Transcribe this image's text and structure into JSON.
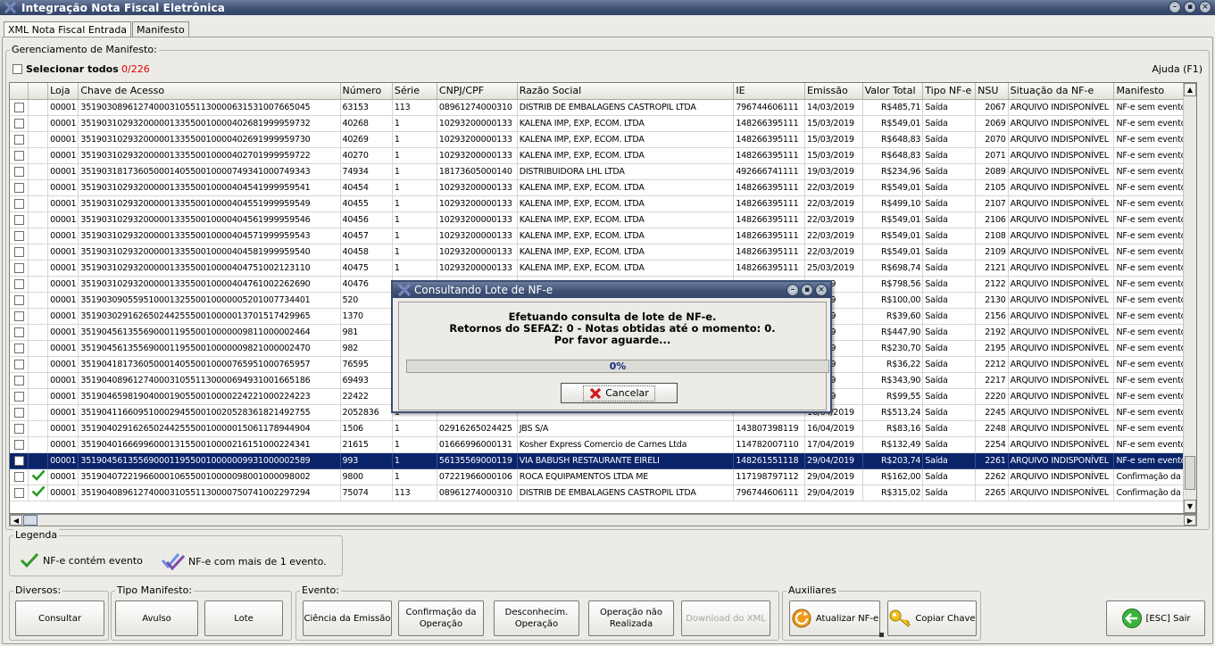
{
  "window": {
    "title": "Integração Nota Fiscal Eletrônica"
  },
  "tabs": [
    {
      "label": "XML Nota Fiscal Entrada"
    },
    {
      "label": "Manifesto"
    }
  ],
  "manager": {
    "legend": "Gerenciamento de Manifesto:",
    "select_all": "Selecionar todos",
    "count": "0/226",
    "help": "Ajuda (F1)"
  },
  "grid": {
    "columns": [
      "",
      "",
      "Loja",
      "Chave de Acesso",
      "Número",
      "Série",
      "CNPJ/CPF",
      "Razão Social",
      "IE",
      "Emissão",
      "Valor Total",
      "Tipo NF-e",
      "NSU",
      "Situação da NF-e",
      "Manifesto"
    ],
    "rows": [
      {
        "loja": "00001",
        "chave": "35190308961274000310551130000631531007665045",
        "numero": "63153",
        "serie": "113",
        "cnpj": "08961274000310",
        "razao": "DISTRIB DE EMBALAGENS CASTROPIL LTDA",
        "ie": "796744606111",
        "emissao": "14/03/2019",
        "valor": "R$485,71",
        "tipo": "Saída",
        "nsu": "2067",
        "situacao": "ARQUIVO INDISPONÍVEL",
        "manifesto": "NF-e sem evento",
        "evento": false,
        "selected": false
      },
      {
        "loja": "00001",
        "chave": "35190310293200000133550010000402681999959732",
        "numero": "40268",
        "serie": "1",
        "cnpj": "10293200000133",
        "razao": "KALENA IMP, EXP, ECOM. LTDA",
        "ie": "148266395111",
        "emissao": "15/03/2019",
        "valor": "R$549,01",
        "tipo": "Saída",
        "nsu": "2069",
        "situacao": "ARQUIVO INDISPONÍVEL",
        "manifesto": "NF-e sem evento",
        "evento": false,
        "selected": false
      },
      {
        "loja": "00001",
        "chave": "35190310293200000133550010000402691999959730",
        "numero": "40269",
        "serie": "1",
        "cnpj": "10293200000133",
        "razao": "KALENA IMP, EXP, ECOM. LTDA",
        "ie": "148266395111",
        "emissao": "15/03/2019",
        "valor": "R$648,83",
        "tipo": "Saída",
        "nsu": "2070",
        "situacao": "ARQUIVO INDISPONÍVEL",
        "manifesto": "NF-e sem evento",
        "evento": false,
        "selected": false
      },
      {
        "loja": "00001",
        "chave": "35190310293200000133550010000402701999959722",
        "numero": "40270",
        "serie": "1",
        "cnpj": "10293200000133",
        "razao": "KALENA IMP, EXP, ECOM. LTDA",
        "ie": "148266395111",
        "emissao": "15/03/2019",
        "valor": "R$648,83",
        "tipo": "Saída",
        "nsu": "2071",
        "situacao": "ARQUIVO INDISPONÍVEL",
        "manifesto": "NF-e sem evento",
        "evento": false,
        "selected": false
      },
      {
        "loja": "00001",
        "chave": "35190318173605000140550010000749341000749343",
        "numero": "74934",
        "serie": "1",
        "cnpj": "18173605000140",
        "razao": "DISTRIBUIDORA LHL LTDA",
        "ie": "492666741111",
        "emissao": "19/03/2019",
        "valor": "R$234,96",
        "tipo": "Saída",
        "nsu": "2089",
        "situacao": "ARQUIVO INDISPONÍVEL",
        "manifesto": "NF-e sem evento",
        "evento": false,
        "selected": false
      },
      {
        "loja": "00001",
        "chave": "35190310293200000133550010000404541999959541",
        "numero": "40454",
        "serie": "1",
        "cnpj": "10293200000133",
        "razao": "KALENA IMP, EXP, ECOM. LTDA",
        "ie": "148266395111",
        "emissao": "22/03/2019",
        "valor": "R$549,01",
        "tipo": "Saída",
        "nsu": "2105",
        "situacao": "ARQUIVO INDISPONÍVEL",
        "manifesto": "NF-e sem evento",
        "evento": false,
        "selected": false
      },
      {
        "loja": "00001",
        "chave": "35190310293200000133550010000404551999959549",
        "numero": "40455",
        "serie": "1",
        "cnpj": "10293200000133",
        "razao": "KALENA IMP, EXP, ECOM. LTDA",
        "ie": "148266395111",
        "emissao": "22/03/2019",
        "valor": "R$499,10",
        "tipo": "Saída",
        "nsu": "2107",
        "situacao": "ARQUIVO INDISPONÍVEL",
        "manifesto": "NF-e sem evento",
        "evento": false,
        "selected": false
      },
      {
        "loja": "00001",
        "chave": "35190310293200000133550010000404561999959546",
        "numero": "40456",
        "serie": "1",
        "cnpj": "10293200000133",
        "razao": "KALENA IMP, EXP, ECOM. LTDA",
        "ie": "148266395111",
        "emissao": "22/03/2019",
        "valor": "R$549,01",
        "tipo": "Saída",
        "nsu": "2106",
        "situacao": "ARQUIVO INDISPONÍVEL",
        "manifesto": "NF-e sem evento",
        "evento": false,
        "selected": false
      },
      {
        "loja": "00001",
        "chave": "35190310293200000133550010000404571999959543",
        "numero": "40457",
        "serie": "1",
        "cnpj": "10293200000133",
        "razao": "KALENA IMP, EXP, ECOM. LTDA",
        "ie": "148266395111",
        "emissao": "22/03/2019",
        "valor": "R$549,01",
        "tipo": "Saída",
        "nsu": "2108",
        "situacao": "ARQUIVO INDISPONÍVEL",
        "manifesto": "NF-e sem evento",
        "evento": false,
        "selected": false
      },
      {
        "loja": "00001",
        "chave": "35190310293200000133550010000404581999959540",
        "numero": "40458",
        "serie": "1",
        "cnpj": "10293200000133",
        "razao": "KALENA IMP, EXP, ECOM. LTDA",
        "ie": "148266395111",
        "emissao": "22/03/2019",
        "valor": "R$549,01",
        "tipo": "Saída",
        "nsu": "2109",
        "situacao": "ARQUIVO INDISPONÍVEL",
        "manifesto": "NF-e sem evento",
        "evento": false,
        "selected": false
      },
      {
        "loja": "00001",
        "chave": "35190310293200000133550010000404751002123110",
        "numero": "40475",
        "serie": "1",
        "cnpj": "10293200000133",
        "razao": "KALENA IMP, EXP, ECOM. LTDA",
        "ie": "148266395111",
        "emissao": "25/03/2019",
        "valor": "R$698,74",
        "tipo": "Saída",
        "nsu": "2121",
        "situacao": "ARQUIVO INDISPONÍVEL",
        "manifesto": "NF-e sem evento",
        "evento": false,
        "selected": false
      },
      {
        "loja": "00001",
        "chave": "35190310293200000133550010000404761002262690",
        "numero": "40476",
        "serie": "",
        "cnpj": "",
        "razao": "",
        "ie": "",
        "emissao": "3/2019",
        "valor": "R$798,56",
        "tipo": "Saída",
        "nsu": "2122",
        "situacao": "ARQUIVO INDISPONÍVEL",
        "manifesto": "NF-e sem evento",
        "evento": false,
        "selected": false
      },
      {
        "loja": "00001",
        "chave": "35190309055951000132550010000005201007734401",
        "numero": "520",
        "serie": "",
        "cnpj": "",
        "razao": "",
        "ie": "",
        "emissao": "3/2019",
        "valor": "R$100,00",
        "tipo": "Saída",
        "nsu": "2130",
        "situacao": "ARQUIVO INDISPONÍVEL",
        "manifesto": "NF-e sem evento",
        "evento": false,
        "selected": false
      },
      {
        "loja": "00001",
        "chave": "35190302916265024425550010000013701517429965",
        "numero": "1370",
        "serie": "",
        "cnpj": "",
        "razao": "",
        "ie": "",
        "emissao": "3/2019",
        "valor": "R$39,60",
        "tipo": "Saída",
        "nsu": "2156",
        "situacao": "ARQUIVO INDISPONÍVEL",
        "manifesto": "NF-e sem evento",
        "evento": false,
        "selected": false
      },
      {
        "loja": "00001",
        "chave": "35190456135569000119550010000009811000002464",
        "numero": "981",
        "serie": "",
        "cnpj": "",
        "razao": "",
        "ie": "",
        "emissao": "4/2019",
        "valor": "R$447,90",
        "tipo": "Saída",
        "nsu": "2192",
        "situacao": "ARQUIVO INDISPONÍVEL",
        "manifesto": "NF-e sem evento",
        "evento": false,
        "selected": false
      },
      {
        "loja": "00001",
        "chave": "35190456135569000119550010000009821000002470",
        "numero": "982",
        "serie": "",
        "cnpj": "",
        "razao": "",
        "ie": "",
        "emissao": "4/2019",
        "valor": "R$230,70",
        "tipo": "Saída",
        "nsu": "2195",
        "situacao": "ARQUIVO INDISPONÍVEL",
        "manifesto": "NF-e sem evento",
        "evento": false,
        "selected": false
      },
      {
        "loja": "00001",
        "chave": "35190418173605000140550010000765951000765957",
        "numero": "76595",
        "serie": "",
        "cnpj": "",
        "razao": "",
        "ie": "",
        "emissao": "4/2019",
        "valor": "R$36,22",
        "tipo": "Saída",
        "nsu": "2212",
        "situacao": "ARQUIVO INDISPONÍVEL",
        "manifesto": "NF-e sem evento",
        "evento": false,
        "selected": false
      },
      {
        "loja": "00001",
        "chave": "35190408961274000310551130000694931001665186",
        "numero": "69493",
        "serie": "",
        "cnpj": "",
        "razao": "",
        "ie": "",
        "emissao": "4/2019",
        "valor": "R$343,90",
        "tipo": "Saída",
        "nsu": "2217",
        "situacao": "ARQUIVO INDISPONÍVEL",
        "manifesto": "NF-e sem evento",
        "evento": false,
        "selected": false
      },
      {
        "loja": "00001",
        "chave": "35190465981904000190550010000224221000224223",
        "numero": "22422",
        "serie": "",
        "cnpj": "",
        "razao": "",
        "ie": "",
        "emissao": "4/2019",
        "valor": "R$99,55",
        "tipo": "Saída",
        "nsu": "2220",
        "situacao": "ARQUIVO INDISPONÍVEL",
        "manifesto": "NF-e sem evento",
        "evento": false,
        "selected": false
      },
      {
        "loja": "00001",
        "chave": "35190411660951000294550010020528361821492755",
        "numero": "2052836",
        "serie": "1",
        "cnpj": "",
        "razao": "",
        "ie": "",
        "emissao": "16/04/2019",
        "valor": "R$513,24",
        "tipo": "Saída",
        "nsu": "2245",
        "situacao": "ARQUIVO INDISPONÍVEL",
        "manifesto": "NF-e sem evento",
        "evento": false,
        "selected": false
      },
      {
        "loja": "00001",
        "chave": "35190402916265024425550010000015061178944904",
        "numero": "1506",
        "serie": "1",
        "cnpj": "02916265024425",
        "razao": "JBS S/A",
        "ie": "143807398119",
        "emissao": "16/04/2019",
        "valor": "R$83,16",
        "tipo": "Saída",
        "nsu": "2248",
        "situacao": "ARQUIVO INDISPONÍVEL",
        "manifesto": "NF-e sem evento",
        "evento": false,
        "selected": false
      },
      {
        "loja": "00001",
        "chave": "35190401666996000131550010000216151000224341",
        "numero": "21615",
        "serie": "1",
        "cnpj": "01666996000131",
        "razao": "Kosher Express Comercio de Carnes Ltda",
        "ie": "114782007110",
        "emissao": "17/04/2019",
        "valor": "R$132,49",
        "tipo": "Saída",
        "nsu": "2254",
        "situacao": "ARQUIVO INDISPONÍVEL",
        "manifesto": "NF-e sem evento",
        "evento": false,
        "selected": false
      },
      {
        "loja": "00001",
        "chave": "35190456135569000119550010000009931000002589",
        "numero": "993",
        "serie": "1",
        "cnpj": "56135569000119",
        "razao": "VIA BABUSH RESTAURANTE EIRELI",
        "ie": "148261551118",
        "emissao": "29/04/2019",
        "valor": "R$203,74",
        "tipo": "Saída",
        "nsu": "2261",
        "situacao": "ARQUIVO INDISPONÍVEL",
        "manifesto": "NF-e sem evento",
        "evento": false,
        "selected": true
      },
      {
        "loja": "00001",
        "chave": "35190407221966000106550010000098001000098002",
        "numero": "9800",
        "serie": "1",
        "cnpj": "07221966000106",
        "razao": "ROCA EQUIPAMENTOS LTDA ME",
        "ie": "117198797112",
        "emissao": "29/04/2019",
        "valor": "R$162,00",
        "tipo": "Saída",
        "nsu": "2262",
        "situacao": "ARQUIVO INDISPONÍVEL",
        "manifesto": "Confirmação da op",
        "evento": true,
        "selected": false
      },
      {
        "loja": "00001",
        "chave": "35190408961274000310551130000750741002297294",
        "numero": "75074",
        "serie": "113",
        "cnpj": "08961274000310",
        "razao": "DISTRIB DE EMBALAGENS CASTROPIL LTDA",
        "ie": "796744606111",
        "emissao": "29/04/2019",
        "valor": "R$315,02",
        "tipo": "Saída",
        "nsu": "2265",
        "situacao": "ARQUIVO INDISPONÍVEL",
        "manifesto": "Confirmação da op",
        "evento": true,
        "selected": false
      }
    ]
  },
  "legend": {
    "title": "Legenda",
    "one_event": "NF-e contém evento",
    "multi_event": "NF-e com mais de 1 evento."
  },
  "groups": {
    "diversos": {
      "label": "Diversos:",
      "consultar": "Consultar"
    },
    "tipo": {
      "label": "Tipo Manifesto:",
      "avulso": "Avulso",
      "lote": "Lote"
    },
    "evento": {
      "label": "Evento:",
      "ciencia": "Ciência da Emissão",
      "confirmacao_1": "Confirmação da",
      "confirmacao_2": "Operação",
      "desconhec_1": "Desconhecim.",
      "desconhec_2": "Operação",
      "nao_realizada_1": "Operação não",
      "nao_realizada_2": "Realizada",
      "download": "Download do XML"
    },
    "aux": {
      "label": "Auxiliares",
      "atualizar": "Atualizar NF-e",
      "copiar": "Copiar Chave"
    },
    "exit": "[ESC] Sair"
  },
  "dialog": {
    "title": "Consultando Lote de NF-e",
    "line1": "Efetuando consulta de lote de NF-e.",
    "line2": "Retornos do SEFAZ: 0 - Notas obtidas até o momento: 0.",
    "line3": "Por favor aguarde...",
    "progress": "0%",
    "progress_value": 0,
    "cancel": "Cancelar"
  },
  "colors": {
    "titlebar": "#3d4f72",
    "selection": "#0a246a",
    "count": "#e00000",
    "check": "#2a9a2a"
  }
}
